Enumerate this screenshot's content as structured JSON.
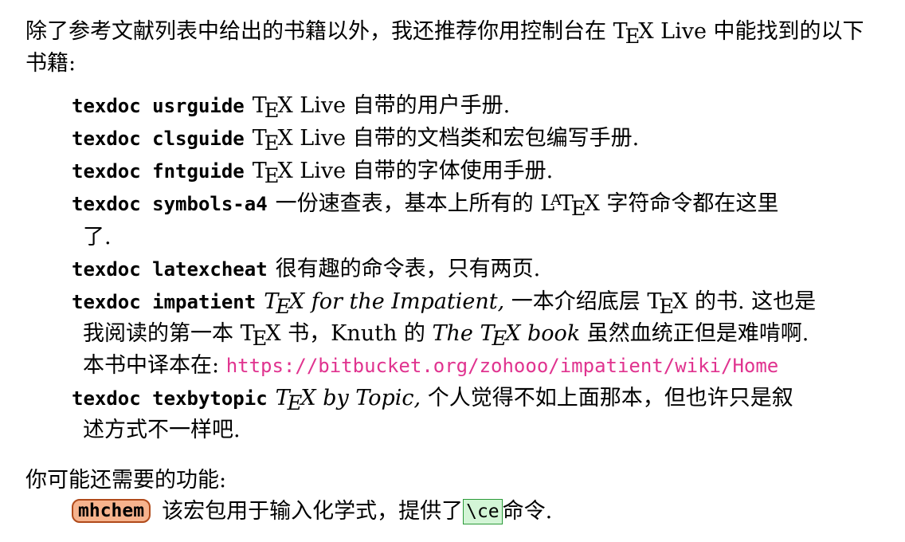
{
  "intro": {
    "text_before": "除了参考文献列表中给出的书籍以外，我还推荐你用控制台在 ",
    "text_after": " Live 中能找到的以下书籍:"
  },
  "items": [
    {
      "cmd": "texdoc usrguide",
      "desc": " Live 自带的用户手册."
    },
    {
      "cmd": "texdoc clsguide",
      "desc": " Live 自带的文档类和宏包编写手册."
    },
    {
      "cmd": "texdoc fntguide",
      "desc": " Live 自带的字体使用手册."
    },
    {
      "cmd": "texdoc symbols-a4",
      "desc_before": "一份速查表，基本上所有的 ",
      "desc_after": " 字符命令都在这里",
      "cont": "了."
    },
    {
      "cmd": "texdoc latexcheat",
      "desc": "很有趣的命令表，只有两页."
    },
    {
      "cmd": "texdoc impatient",
      "title_italic": " for the Impatient,",
      "desc1": " 一本介绍底层 ",
      "desc2": " 的书. 这也是",
      "cont1_a": "我阅读的第一本 ",
      "cont1_b": " 书，Knuth 的 ",
      "cont1_c": "The ",
      "cont1_d": " book",
      "cont1_e": " 虽然血统正但是难啃啊.",
      "cont2_label": "本书中译本在: ",
      "url": "https://bitbucket.org/zohooo/impatient/wiki/Home"
    },
    {
      "cmd": "texdoc texbytopic",
      "title_italic": " by Topic,",
      "desc": " 个人觉得不如上面那本，但也许只是叙",
      "cont": "述方式不一样吧."
    }
  ],
  "section": {
    "heading": "你可能还需要的功能:",
    "package": "mhchem",
    "desc_before": "该宏包用于输入化学式，提供了",
    "code": "\\ce",
    "desc_after": "命令."
  },
  "tex_logo": {
    "t": "T",
    "e": "E",
    "x": "X"
  },
  "latex_logo": {
    "l": "L",
    "a": "A"
  },
  "colors": {
    "url": "#e0338f",
    "package_bg": "#f6b38d",
    "package_border": "#b04a1a",
    "code_bg": "#d3f5d6",
    "code_border": "#2c9a3a"
  }
}
